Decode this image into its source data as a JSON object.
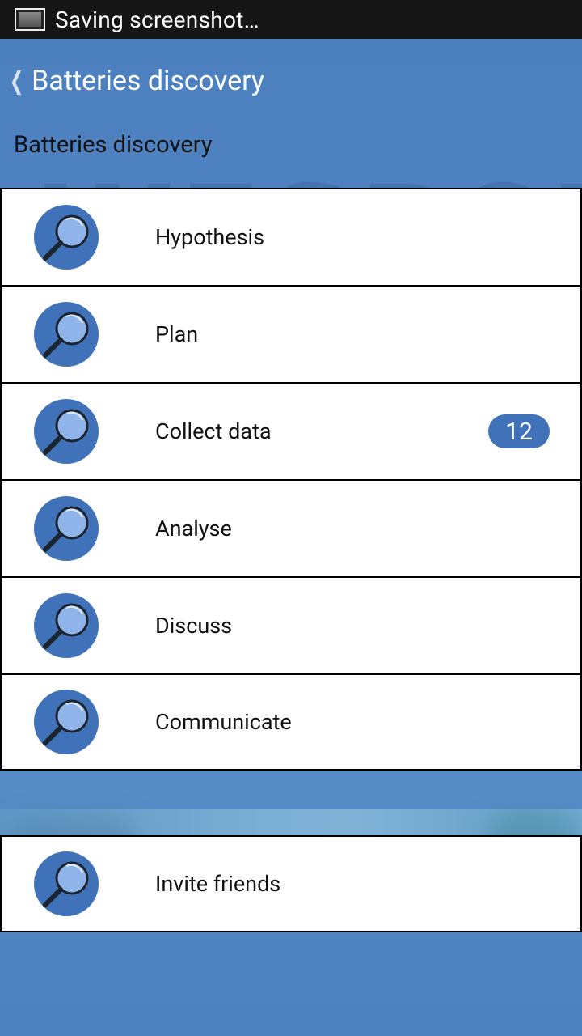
{
  "statusbar": {
    "text": "Saving screenshot…"
  },
  "actionbar": {
    "title": "Batteries discovery"
  },
  "section": {
    "title": "Batteries discovery"
  },
  "watermark": "WESPOT",
  "colors": {
    "accent": "#3f72b8",
    "background": "#4a7fbd"
  },
  "menu": [
    {
      "label": "Hypothesis",
      "icon": "magnifier-icon"
    },
    {
      "label": "Plan",
      "icon": "magnifier-icon"
    },
    {
      "label": "Collect data",
      "icon": "magnifier-icon",
      "badge": "12"
    },
    {
      "label": "Analyse",
      "icon": "magnifier-icon"
    },
    {
      "label": "Discuss",
      "icon": "magnifier-icon"
    },
    {
      "label": "Communicate",
      "icon": "magnifier-icon"
    }
  ],
  "extra": [
    {
      "label": "Invite friends",
      "icon": "magnifier-icon"
    }
  ]
}
